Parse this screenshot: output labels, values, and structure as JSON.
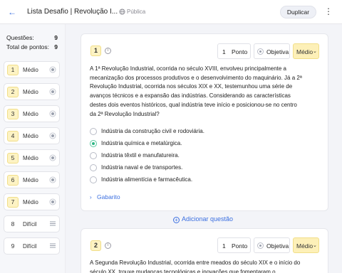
{
  "header": {
    "title": "Lista Desafio | Revolução I...",
    "visibility": "Pública",
    "duplicate_label": "Duplicar"
  },
  "sidebar": {
    "questions_label": "Questões:",
    "questions_count": "9",
    "points_label": "Total de pontos:",
    "points_count": "9",
    "items": [
      {
        "number": "1",
        "difficulty": "Médio",
        "icon": "objective-radio-icon"
      },
      {
        "number": "2",
        "difficulty": "Médio",
        "icon": "objective-radio-icon"
      },
      {
        "number": "3",
        "difficulty": "Médio",
        "icon": "objective-radio-icon"
      },
      {
        "number": "4",
        "difficulty": "Médio",
        "icon": "objective-radio-icon"
      },
      {
        "number": "5",
        "difficulty": "Médio",
        "icon": "objective-radio-icon"
      },
      {
        "number": "6",
        "difficulty": "Médio",
        "icon": "objective-radio-icon"
      },
      {
        "number": "7",
        "difficulty": "Médio",
        "icon": "objective-radio-icon"
      },
      {
        "number": "8",
        "difficulty": "Difícil",
        "icon": "text-lines-icon"
      },
      {
        "number": "9",
        "difficulty": "Difícil",
        "icon": "text-lines-icon"
      }
    ]
  },
  "questions": [
    {
      "number": "1",
      "points_value": "1",
      "points_unit": "Ponto",
      "type": "Objetiva",
      "difficulty": "Médio",
      "text": "A 1ª Revolução Industrial, ocorrida no século XVIII, envolveu principalmente a mecanização dos processos produtivos e o desenvolvimento do maquinário. Já a 2ª Revolução Industrial, ocorrida nos séculos XIX e XX, testemunhou uma série de avanços técnicos e a expansão das indústrias. Considerando as características destes dois eventos históricos, qual indústria teve início e posicionou-se no centro da 2ª Revolução Industrial?",
      "options": [
        {
          "text": "Indústria da construção civil e rodoviária.",
          "selected": false
        },
        {
          "text": "Indústria química e metalúrgica.",
          "selected": true
        },
        {
          "text": "Indústria têxtil e manufatureira.",
          "selected": false
        },
        {
          "text": "Indústria naval e de transportes.",
          "selected": false
        },
        {
          "text": "Indústria alimentícia e farmacêutica.",
          "selected": false
        }
      ],
      "answer_key_label": "Gabarito"
    },
    {
      "number": "2",
      "points_value": "1",
      "points_unit": "Ponto",
      "type": "Objetiva",
      "difficulty": "Médio",
      "text": "A Segunda Revolução Industrial, ocorrida entre meados do século XIX e o início do século XX, trouxe mudanças tecnológicas e inovações que fomentaram o"
    }
  ],
  "add_question_label": "Adicionar questão",
  "colors": {
    "accent": "#3b6fe0",
    "badge": "#fdf3c4",
    "selected": "#2fb685"
  }
}
